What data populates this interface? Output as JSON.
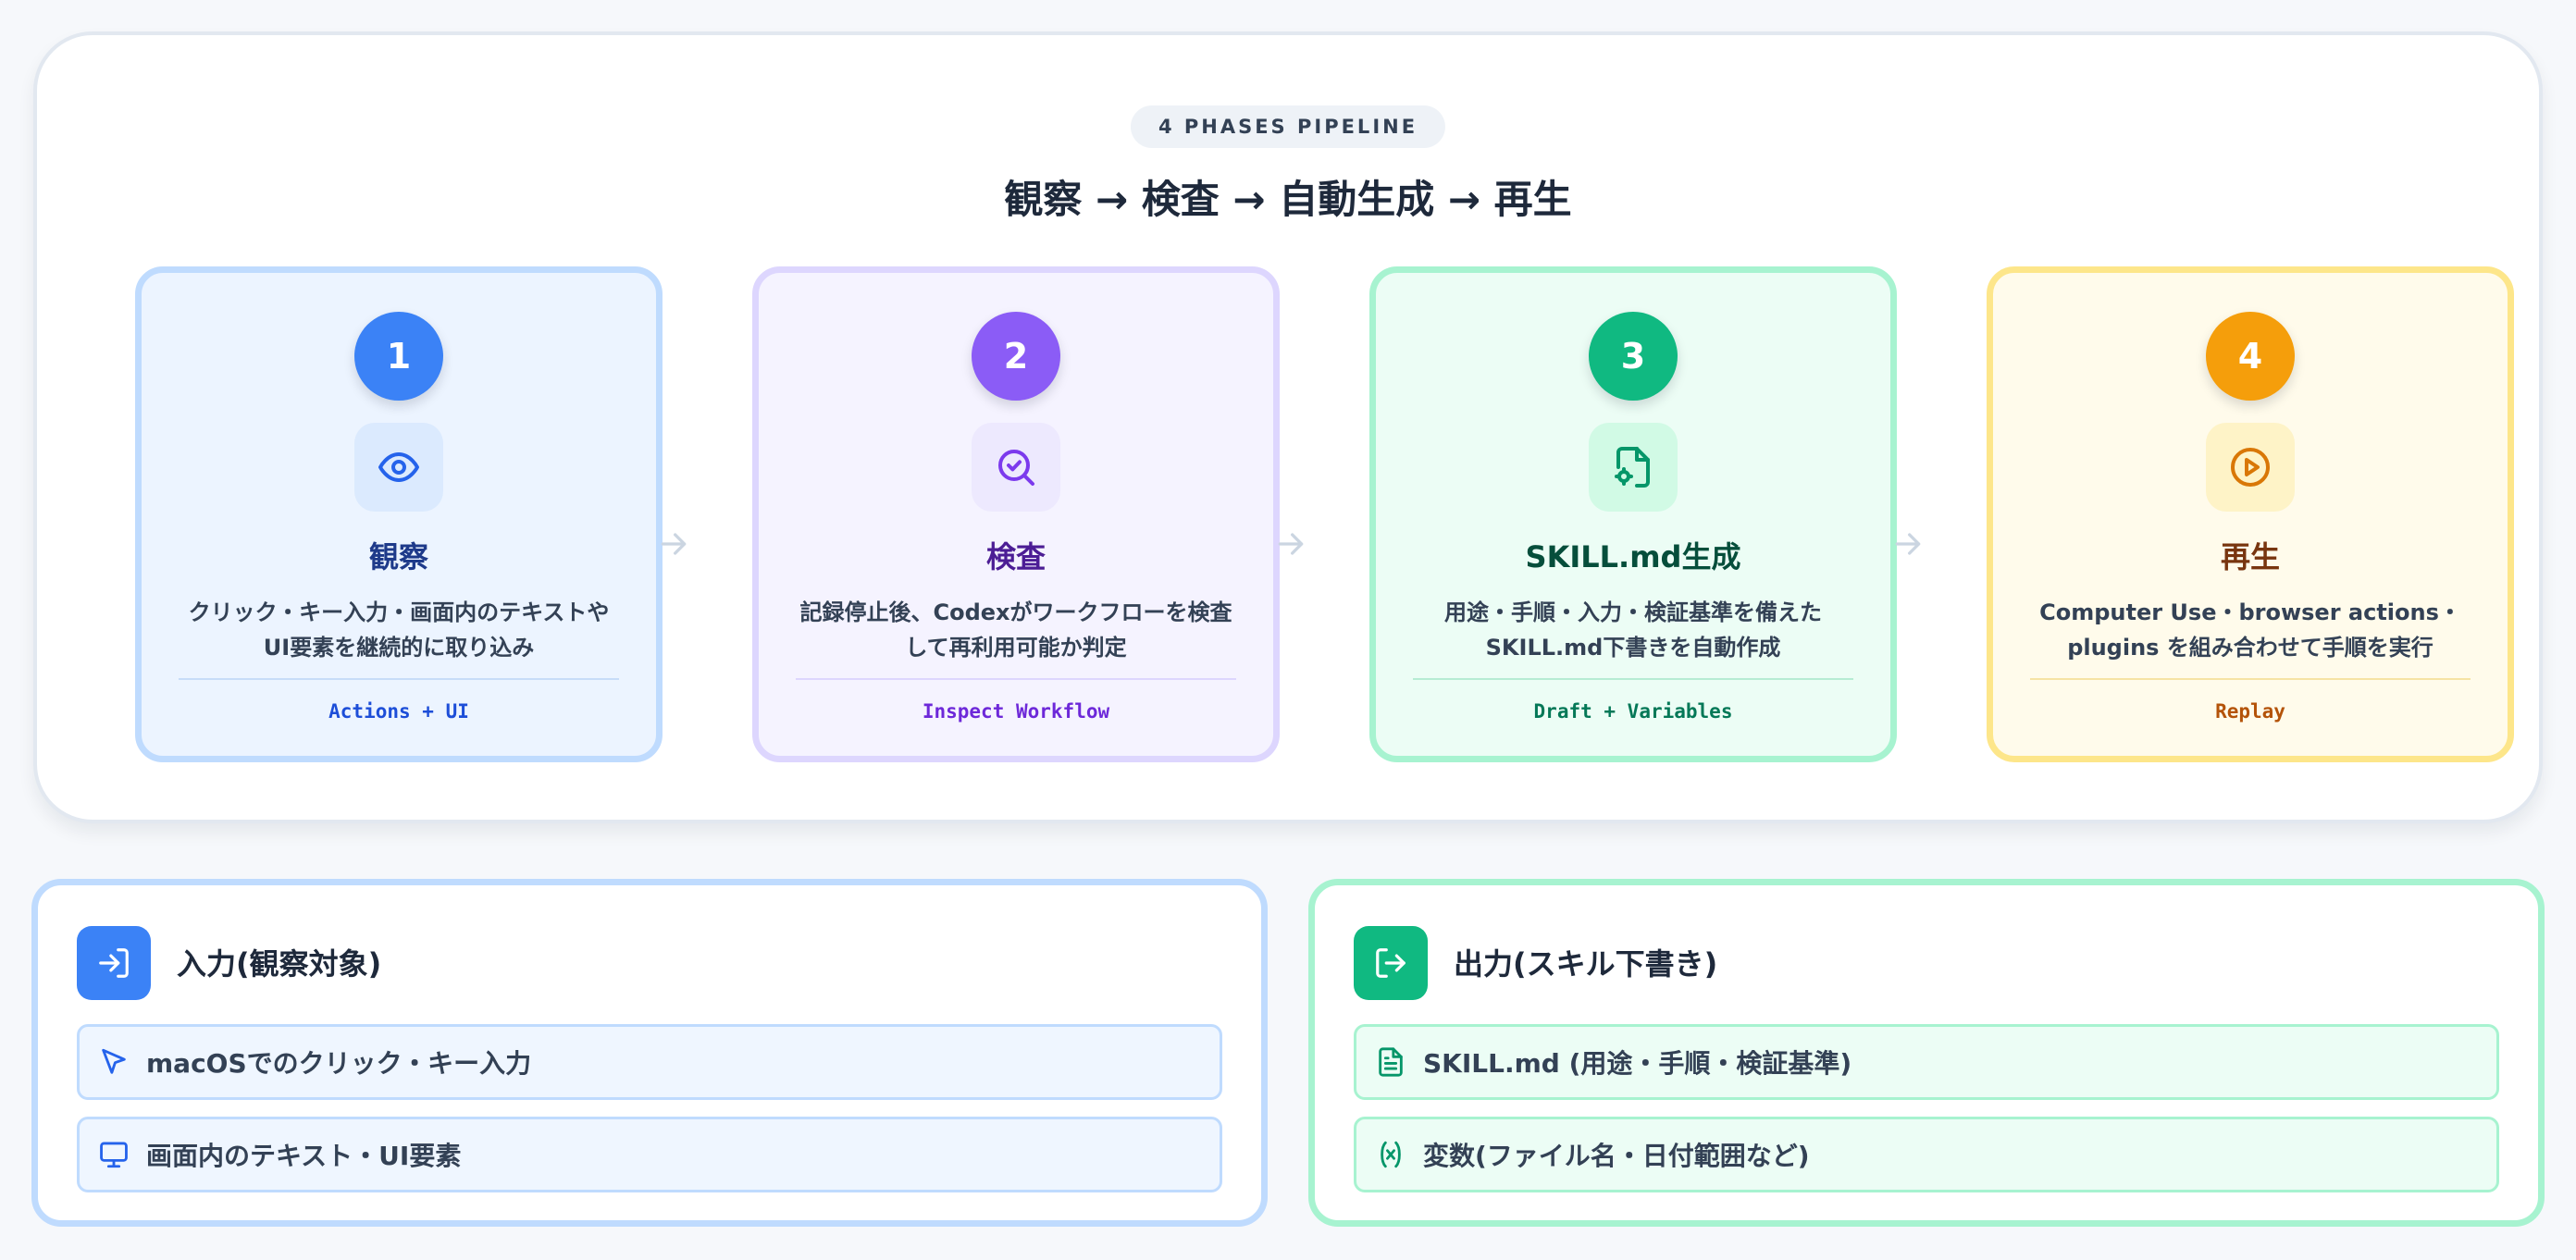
{
  "pipeline": {
    "eyebrow": "4 PHASES PIPELINE",
    "headline": "観察 → 検査 → 自動生成 → 再生",
    "phases": [
      {
        "number": "1",
        "icon": "eye-icon",
        "title": "観察",
        "desc_line1": "クリック・キー入力・画面内のテキストや",
        "desc_line2": "UI要素を継続的に取り込み",
        "tag": "Actions + UI",
        "color": "#3b82f6"
      },
      {
        "number": "2",
        "icon": "search-check-icon",
        "title": "検査",
        "desc_line1": "記録停止後、Codexがワークフローを検査",
        "desc_line2": "して再利用可能か判定",
        "tag": "Inspect Workflow",
        "color": "#8b5cf6"
      },
      {
        "number": "3",
        "icon": "file-cog-icon",
        "title": "SKILL.md生成",
        "desc_line1": "用途・手順・入力・検証基準を備えた",
        "desc_line2": "SKILL.md下書きを自動作成",
        "tag": "Draft + Variables",
        "color": "#10b981"
      },
      {
        "number": "4",
        "icon": "play-circle-icon",
        "title": "再生",
        "desc_line1": "Computer Use・browser actions・",
        "desc_line2": "plugins を組み合わせて手順を実行",
        "tag": "Replay",
        "color": "#f59e0b"
      }
    ]
  },
  "input_panel": {
    "icon": "log-in-icon",
    "title": "入力(観察対象)",
    "color": "#3b82f6",
    "items": [
      {
        "icon": "cursor-arrow-icon",
        "label": "macOSでのクリック・キー入力"
      },
      {
        "icon": "monitor-icon",
        "label": "画面内のテキスト・UI要素"
      }
    ]
  },
  "output_panel": {
    "icon": "log-out-icon",
    "title": "出力(スキル下書き)",
    "color": "#10b981",
    "items": [
      {
        "icon": "document-icon",
        "label": "SKILL.md (用途・手順・検証基準)"
      },
      {
        "icon": "variable-icon",
        "label": "変数(ファイル名・日付範囲など)"
      }
    ]
  }
}
